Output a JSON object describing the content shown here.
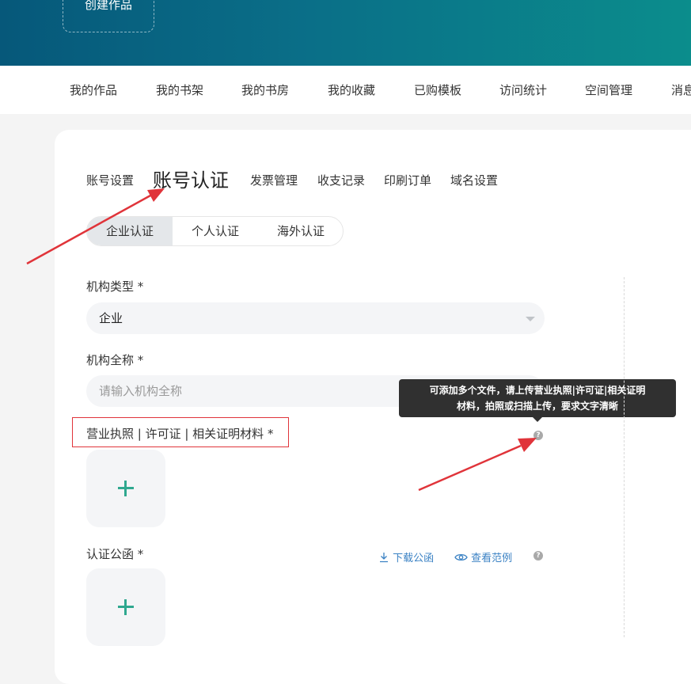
{
  "header": {
    "create_label": "创建作品"
  },
  "nav": {
    "items": [
      "我的作品",
      "我的书架",
      "我的书房",
      "我的收藏",
      "已购模板",
      "访问统计",
      "空间管理",
      "消息"
    ]
  },
  "settings_tabs": {
    "items": [
      "账号设置",
      "账号认证",
      "发票管理",
      "收支记录",
      "印刷订单",
      "域名设置"
    ],
    "active": "账号认证"
  },
  "auth_types": {
    "items": [
      "企业认证",
      "个人认证",
      "海外认证"
    ],
    "active": "企业认证"
  },
  "form": {
    "org_type": {
      "label": "机构类型 *",
      "value": "企业"
    },
    "org_name": {
      "label": "机构全称 *",
      "placeholder": "请输入机构全称"
    },
    "license": {
      "label": "营业执照 | 许可证 | 相关证明材料 *",
      "tooltip_line1": "可添加多个文件，请上传营业执照|许可证|相关证明",
      "tooltip_line2": "材料，拍照或扫描上传，要求文字清晰",
      "help_icon": "question-icon"
    },
    "letter": {
      "label": "认证公函 *",
      "download_label": "下载公函",
      "view_label": "查看范例",
      "download_icon": "download-icon",
      "view_icon": "eye-icon"
    },
    "upload_icon": "plus-icon"
  },
  "colors": {
    "accent": "#2fa88f",
    "link": "#3b82c4",
    "annotation_red": "#e0343a",
    "header_start": "#06587a",
    "header_end": "#0b8d8c"
  }
}
